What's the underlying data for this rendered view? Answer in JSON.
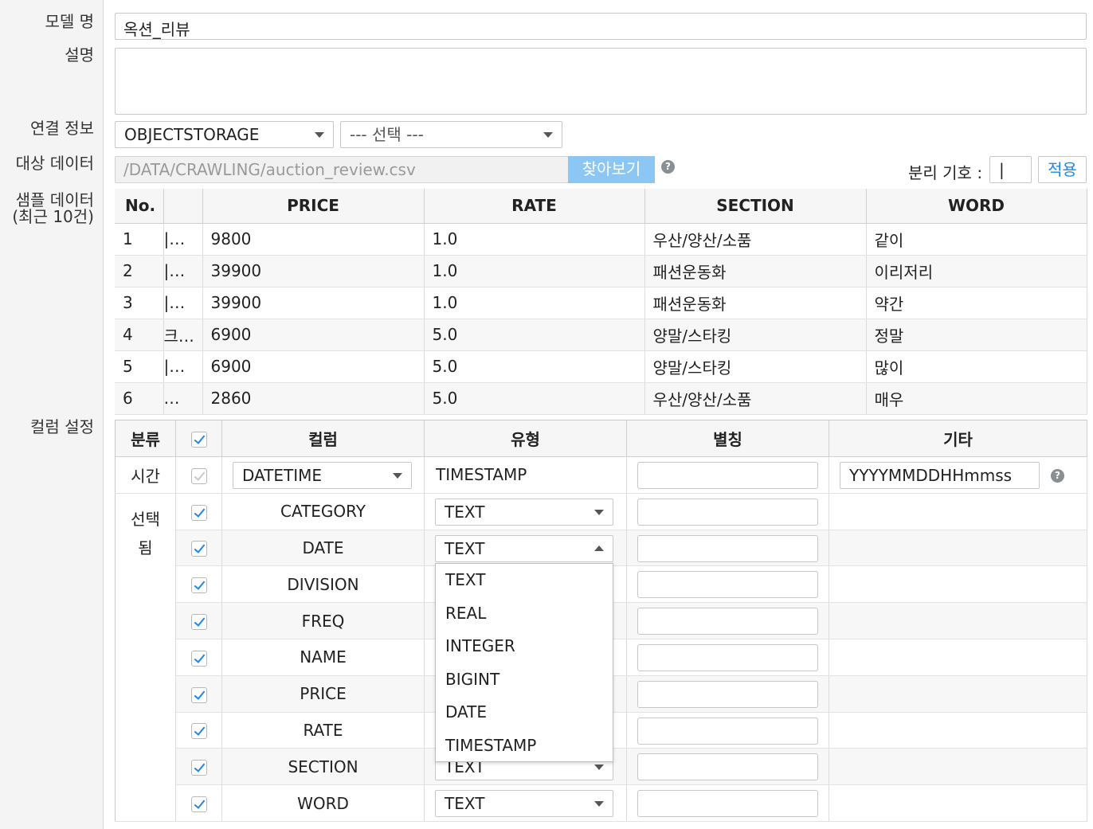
{
  "labels": {
    "model_name": "모델 명",
    "description": "설명",
    "connection": "연결 정보",
    "target_data": "대상 데이터",
    "sample_data_line1": "샘플 데이터",
    "sample_data_line2": "(최근 10건)",
    "column_settings": "컬럼 설정"
  },
  "model_name_value": "옥션_리뷰",
  "description_value": "",
  "connection": {
    "storage_value": "OBJECTSTORAGE",
    "select_placeholder": "--- 선택 ---"
  },
  "target": {
    "path_value": "/DATA/CRAWLING/auction_review.csv",
    "browse_button": "찾아보기",
    "separator_label": "분리 기호 :",
    "separator_value": "|",
    "apply_button": "적용",
    "help_icon": "?"
  },
  "sample": {
    "headers": [
      "No.",
      "",
      "PRICE",
      "RATE",
      "SECTION",
      "WORD"
    ],
    "rows": [
      [
        "1",
        "|…",
        "9800",
        "1.0",
        "우산/양산/소품",
        "같이"
      ],
      [
        "2",
        "|…",
        "39900",
        "1.0",
        "패션운동화",
        "이리저리"
      ],
      [
        "3",
        "|…",
        "39900",
        "1.0",
        "패션운동화",
        "약간"
      ],
      [
        "4",
        "크…",
        "6900",
        "5.0",
        "양말/스타킹",
        "정말"
      ],
      [
        "5",
        "|…",
        "6900",
        "5.0",
        "양말/스타킹",
        "많이"
      ],
      [
        "6",
        "…",
        "2860",
        "5.0",
        "우산/양산/소품",
        "매우"
      ]
    ]
  },
  "columns": {
    "headers": {
      "category": "분류",
      "column": "컬럼",
      "type": "유형",
      "alias": "별칭",
      "etc": "기타"
    },
    "time_group": "시간",
    "selected_group_line1": "선택",
    "selected_group_line2": "됨",
    "time_row": {
      "column_value": "DATETIME",
      "type_value": "TIMESTAMP",
      "etc_value": "YYYYMMDDHHmmss"
    },
    "rows": [
      {
        "name": "CATEGORY",
        "type": "TEXT"
      },
      {
        "name": "DATE",
        "type": "TEXT"
      },
      {
        "name": "DIVISION",
        "type": ""
      },
      {
        "name": "FREQ",
        "type": ""
      },
      {
        "name": "NAME",
        "type": ""
      },
      {
        "name": "PRICE",
        "type": ""
      },
      {
        "name": "RATE",
        "type": ""
      },
      {
        "name": "SECTION",
        "type": "TEXT"
      },
      {
        "name": "WORD",
        "type": "TEXT"
      }
    ],
    "type_options": [
      "TEXT",
      "REAL",
      "INTEGER",
      "BIGINT",
      "DATE",
      "TIMESTAMP"
    ]
  },
  "colors": {
    "accent": "#1e88e5",
    "browse_button_bg": "#8cc6f4",
    "panel_bg": "#f4f4f4"
  }
}
